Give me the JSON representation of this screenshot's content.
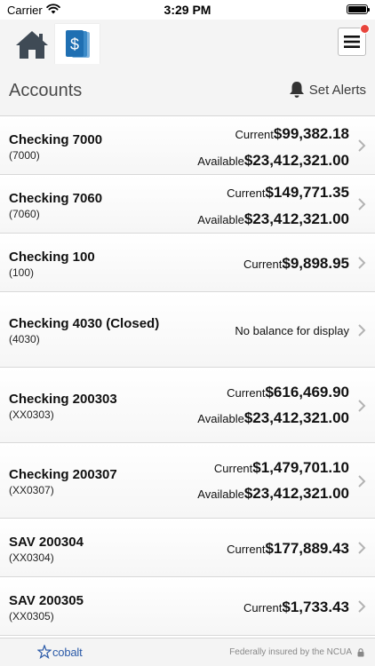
{
  "status_bar": {
    "carrier": "Carrier",
    "time": "3:29 PM"
  },
  "nav": {
    "home_icon": "home-icon",
    "accounts_icon": "accounts-dollar-icon",
    "menu_icon": "hamburger-menu-icon",
    "notification_color": "#e8453c"
  },
  "header": {
    "title": "Accounts",
    "set_alerts": "Set Alerts"
  },
  "accounts": [
    {
      "name": "Checking 7000",
      "number": "(7000)",
      "current_label": "Current",
      "current": "$99,382.18",
      "available_label": "Available",
      "available": "$23,412,321.00"
    },
    {
      "name": "Checking 7060",
      "number": "(7060)",
      "current_label": "Current",
      "current": "$149,771.35",
      "available_label": "Available",
      "available": "$23,412,321.00"
    },
    {
      "name": "Checking 100",
      "number": "(100)",
      "current_label": "Current",
      "current": "$9,898.95"
    },
    {
      "name": "Checking 4030 (Closed)",
      "number": "(4030)",
      "no_balance": "No balance for display"
    },
    {
      "name": "Checking 200303",
      "number": "(XX0303)",
      "current_label": "Current",
      "current": "$616,469.90",
      "available_label": "Available",
      "available": "$23,412,321.00"
    },
    {
      "name": "Checking 200307",
      "number": "(XX0307)",
      "current_label": "Current",
      "current": "$1,479,701.10",
      "available_label": "Available",
      "available": "$23,412,321.00"
    },
    {
      "name": "SAV 200304",
      "number": "(XX0304)",
      "current_label": "Current",
      "current": "$177,889.43"
    },
    {
      "name": "SAV 200305",
      "number": "(XX0305)",
      "current_label": "Current",
      "current": "$1,733.43"
    }
  ],
  "footer": {
    "logo_text": "cobalt",
    "note": "Federally insured by the NCUA"
  },
  "colors": {
    "accent_blue": "#1f6fb2",
    "icon_gray": "#3f4a55",
    "chevron_gray": "#b3b3b3"
  }
}
